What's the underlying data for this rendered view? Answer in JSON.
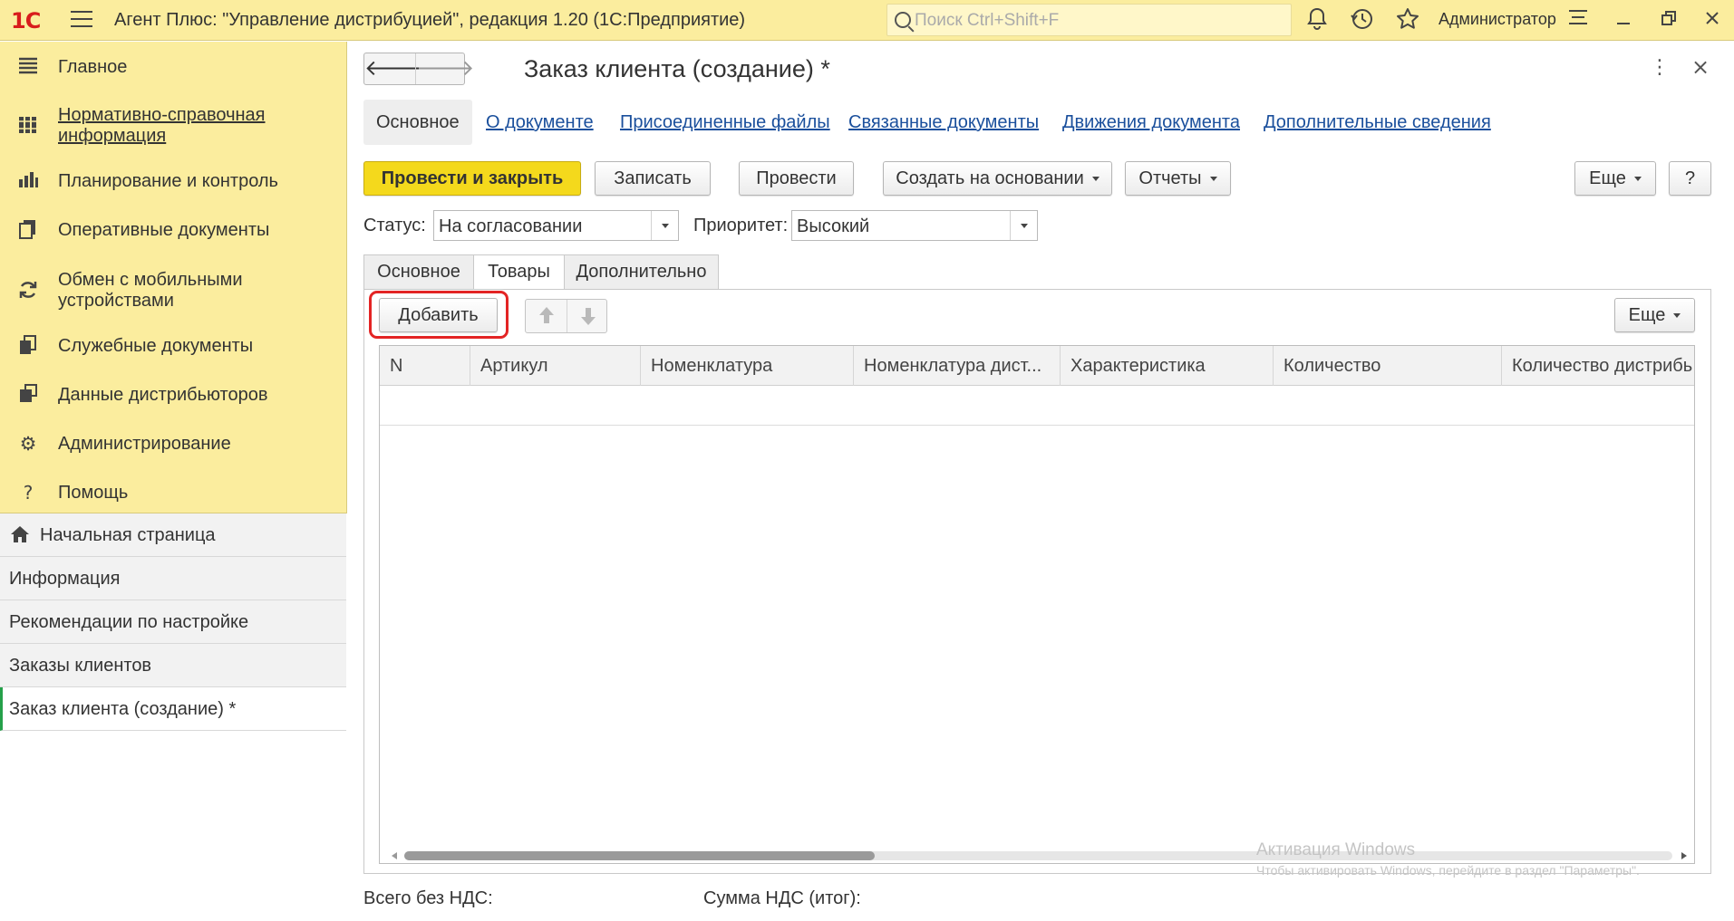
{
  "app": {
    "logo_text": "1С",
    "title": "Агент Плюс: \"Управление дистрибуцией\", редакция 1.20  (1С:Предприятие)",
    "search_placeholder": "Поиск Ctrl+Shift+F",
    "user_name": "Администратор",
    "icons": [
      "bell-icon",
      "history-icon",
      "star-icon",
      "settings-list-icon",
      "minimize-icon",
      "restore-icon",
      "close-icon"
    ]
  },
  "sidebar": {
    "sections": [
      {
        "label": "Главное",
        "icon": "list-icon",
        "underlined": false
      },
      {
        "label": "Нормативно-справочная информация",
        "icon": "books-icon",
        "underlined": true
      },
      {
        "label": "Планирование и контроль",
        "icon": "bar-chart-icon",
        "underlined": false
      },
      {
        "label": "Оперативные документы",
        "icon": "documents-icon",
        "underlined": false
      },
      {
        "label": "Обмен с мобильными устройствами",
        "icon": "sync-icon",
        "underlined": false
      },
      {
        "label": "Служебные документы",
        "icon": "service-docs-icon",
        "underlined": false
      },
      {
        "label": "Данные дистрибьюторов",
        "icon": "distributor-data-icon",
        "underlined": false
      },
      {
        "label": "Администрирование",
        "icon": "gear-icon",
        "underlined": false
      },
      {
        "label": "Помощь",
        "icon": "question-icon",
        "underlined": false
      }
    ],
    "open_windows": [
      {
        "label": "Начальная страница",
        "icon": "home-icon"
      },
      {
        "label": "Информация"
      },
      {
        "label": "Рекомендации по настройке"
      },
      {
        "label": "Заказы клиентов"
      },
      {
        "label": "Заказ клиента (создание) *",
        "active": true
      }
    ]
  },
  "form": {
    "title": "Заказ клиента (создание) *",
    "nav": {
      "back": "🡐",
      "forward": "🡒"
    },
    "menu_glyph": "⋮",
    "close_glyph": "×",
    "top_tabs": [
      {
        "label": "Основное",
        "active": true
      },
      {
        "label": "О документе"
      },
      {
        "label": "Присоединенные файлы"
      },
      {
        "label": "Связанные документы"
      },
      {
        "label": "Движения документа"
      },
      {
        "label": "Дополнительные сведения"
      }
    ],
    "toolbar": {
      "post_and_close": "Провести и закрыть",
      "save": "Записать",
      "post": "Провести",
      "create_based_on": "Создать на основании",
      "reports": "Отчеты",
      "more": "Еще",
      "help": "?"
    },
    "status": {
      "label": "Статус:",
      "value": "На согласовании"
    },
    "priority": {
      "label": "Приоритет:",
      "value": "Высокий"
    },
    "sub_tabs": [
      {
        "label": "Основное"
      },
      {
        "label": "Товары",
        "active": true
      },
      {
        "label": "Дополнительно"
      }
    ],
    "goods": {
      "add_label": "Добавить",
      "more_label": "Еще",
      "columns": [
        "N",
        "Артикул",
        "Номенклатура",
        "Номенклатура дист...",
        "Характеристика",
        "Количество",
        "Количество дистрибь"
      ],
      "rows": []
    },
    "totals": {
      "without_vat_label": "Всего без НДС:",
      "vat_label": "Сумма НДС (итог):"
    }
  },
  "watermark": {
    "line1": "Активация Windows",
    "line2": "Чтобы активировать Windows, перейдите в раздел \"Параметры\"."
  }
}
